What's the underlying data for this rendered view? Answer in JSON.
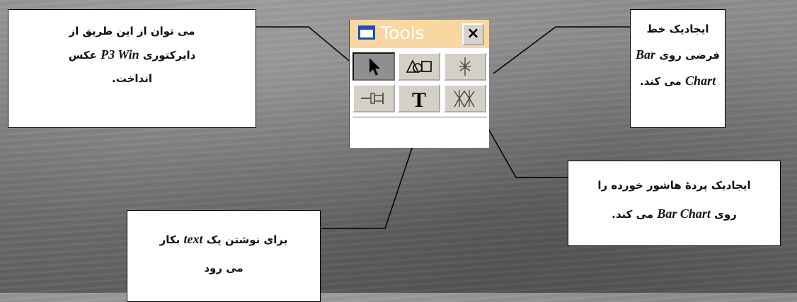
{
  "tools_window": {
    "title": "Tools",
    "close_label": "×",
    "buttons": [
      {
        "name": "select",
        "icon": "arrow-pointer-icon",
        "active": true
      },
      {
        "name": "shapes",
        "icon": "shapes-icon",
        "active": false
      },
      {
        "name": "line",
        "icon": "vertical-line-icon",
        "active": false
      },
      {
        "name": "pin",
        "icon": "pin-icon",
        "active": false
      },
      {
        "name": "text",
        "icon": "text-T-icon",
        "label": "T",
        "active": false
      },
      {
        "name": "hatch",
        "icon": "hatch-icon",
        "active": false
      }
    ]
  },
  "callouts": {
    "directory": {
      "line1": "می توان از این طریق از",
      "line2_before": "دایرکتوری",
      "line2_em": "P3 Win",
      "line2_after": "عکس",
      "line3": "انداخت."
    },
    "text_tool": {
      "line1_before": "برای نوشتن یک",
      "line1_em": "text",
      "line1_after": "بکار",
      "line2": "می رود"
    },
    "line_tool": {
      "line1": "ایجادیک خط",
      "line2_before": "فرضی روی",
      "line2_em": "Bar",
      "line3_em": "Chart",
      "line3_after": "می کند."
    },
    "hatch_tool": {
      "line1": "ایجادیک پردۀ هاشور خورده را",
      "line2_before": "روی",
      "line2_em": "Bar Chart",
      "line2_after": "می کند."
    }
  },
  "colors": {
    "title_bar": "#f8d8a0",
    "window_icon": "#1d4fb3",
    "button_face": "#d4d0c8",
    "active_button": "#8f8f8f"
  }
}
